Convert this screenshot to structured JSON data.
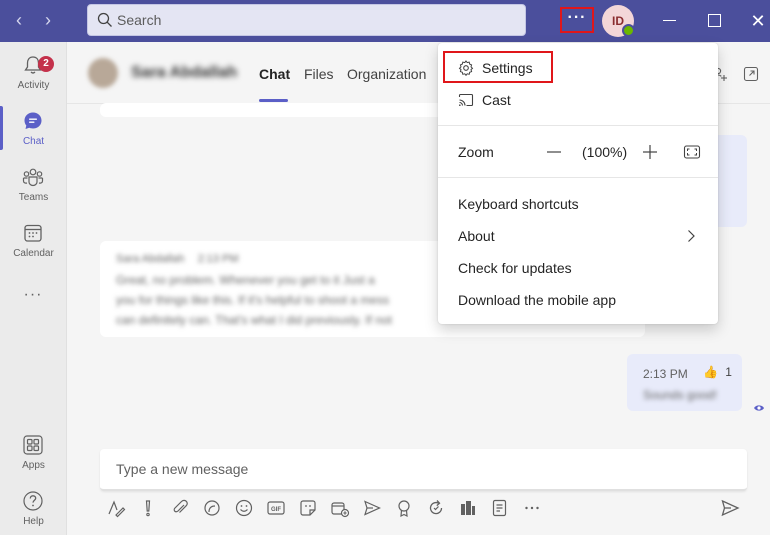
{
  "titlebar": {
    "back_glyph": "‹",
    "forward_glyph": "›",
    "search_placeholder": "Search",
    "more_glyph": "···",
    "avatar_initials": "ID",
    "close_glyph": "✕",
    "accent_color": "#4b4f9c"
  },
  "rail": {
    "items": [
      {
        "label": "Activity",
        "icon": "bell-icon",
        "badge": "2"
      },
      {
        "label": "Chat",
        "icon": "chat-icon"
      },
      {
        "label": "Teams",
        "icon": "teams-icon"
      },
      {
        "label": "Calendar",
        "icon": "calendar-icon"
      },
      {
        "label": "Apps",
        "icon": "apps-icon"
      },
      {
        "label": "Help",
        "icon": "help-icon"
      }
    ],
    "more_glyph": "···"
  },
  "chat_header": {
    "contact_name": "Sara Abdallah",
    "tabs": [
      {
        "label": "Chat",
        "active": true
      },
      {
        "label": "Files"
      },
      {
        "label": "Organization"
      }
    ]
  },
  "messages": {
    "incoming_sender": "Sara Abdallah",
    "incoming_time": "2:13 PM",
    "incoming_text_1": "Great, no problem. Whenever you get to it  Just a",
    "incoming_text_2": "you for things like this. If it's helpful to shoot a mess",
    "incoming_text_3": "can definitely can. That's what I did previously. If not",
    "own_time": "2:13 PM",
    "own_reaction": "👍",
    "own_reaction_count": "1",
    "own_text": "Sounds good!"
  },
  "compose": {
    "placeholder": "Type a new message"
  },
  "menu": {
    "settings_label": "Settings",
    "cast_label": "Cast",
    "zoom_label": "Zoom",
    "zoom_value": "(100%)",
    "zoom_minus": "−",
    "zoom_plus": "+",
    "keyboard_shortcuts_label": "Keyboard shortcuts",
    "about_label": "About",
    "check_updates_label": "Check for updates",
    "download_label": "Download the mobile app"
  }
}
